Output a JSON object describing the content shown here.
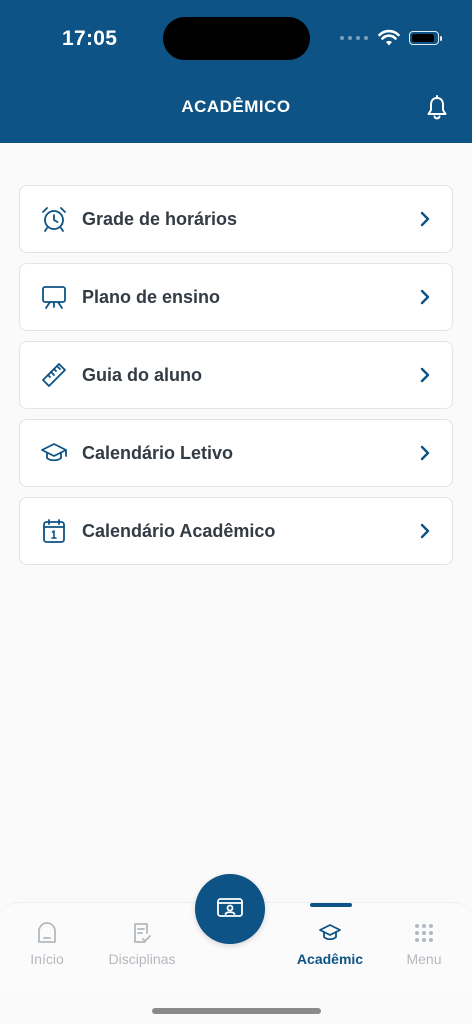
{
  "status_bar": {
    "time": "17:05"
  },
  "header": {
    "title": "ACADÊMICO"
  },
  "menu": {
    "items": [
      {
        "label": "Grade de horários",
        "icon": "alarm-clock-icon"
      },
      {
        "label": "Plano de ensino",
        "icon": "presentation-board-icon"
      },
      {
        "label": "Guia do aluno",
        "icon": "ruler-icon"
      },
      {
        "label": "Calendário Letivo",
        "icon": "graduation-cap-icon"
      },
      {
        "label": "Calendário Acadêmico",
        "icon": "calendar-icon"
      }
    ]
  },
  "bottom_nav": {
    "items": [
      {
        "label": "Início",
        "icon": "home-icon",
        "active": false
      },
      {
        "label": "Disciplinas",
        "icon": "document-check-icon",
        "active": false
      },
      {
        "label": "Acadêmic",
        "icon": "graduation-cap-icon",
        "active": true
      },
      {
        "label": "Menu",
        "icon": "grid-dots-icon",
        "active": false
      }
    ],
    "center_button_icon": "id-card-icon"
  },
  "colors": {
    "primary": "#0d5385",
    "text": "#333b44",
    "inactive": "#b4b9bf",
    "background": "#fafafa"
  }
}
